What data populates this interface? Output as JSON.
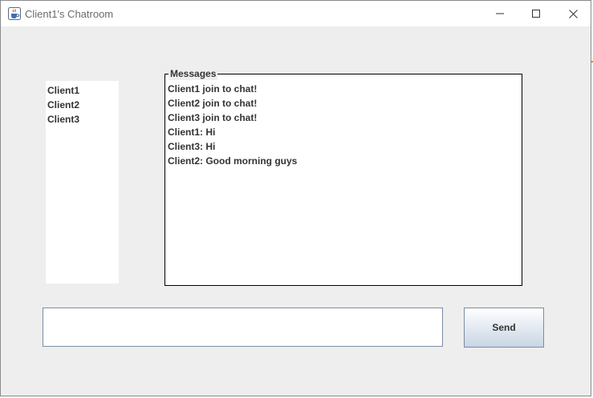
{
  "window": {
    "title": "Client1's Chatroom",
    "app_icon": "java-coffee-cup-icon",
    "controls": {
      "minimize_icon": "minimize-icon",
      "maximize_icon": "maximize-icon",
      "close_icon": "close-icon"
    }
  },
  "clients": {
    "items": [
      "Client1",
      "Client2",
      "Client3"
    ]
  },
  "messages": {
    "legend": "Messages",
    "lines": [
      "Client1 join to chat!",
      "Client2 join to chat!",
      "Client3 join to chat!",
      "Client1: Hi",
      "Client3: Hi",
      "Client2: Good morning guys"
    ]
  },
  "composer": {
    "input_value": "",
    "send_label": "Send"
  },
  "colors": {
    "window_bg": "#eeeeee",
    "button_border": "#7a8ca3",
    "text": "#333333"
  }
}
